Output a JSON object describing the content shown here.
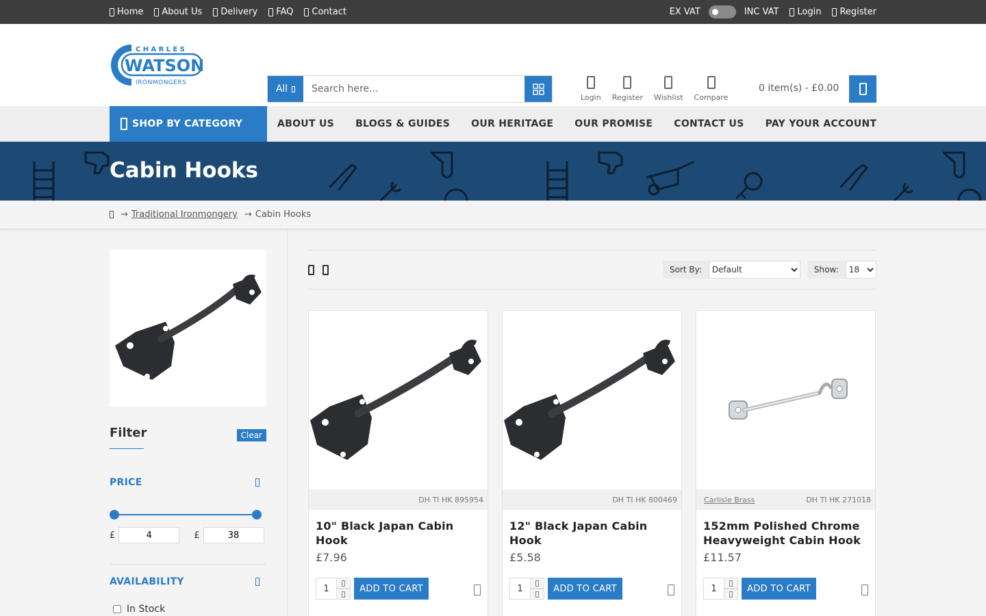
{
  "topbar": {
    "links": [
      "Home",
      "About Us",
      "Delivery",
      "FAQ",
      "Contact"
    ],
    "ex_vat": "EX VAT",
    "inc_vat": "INC VAT",
    "login": "Login",
    "register": "Register"
  },
  "logo": {
    "line1": "CHARLES",
    "line2": "WATSON",
    "line3": "IRONMONGERS",
    "color": "#2a7cc7"
  },
  "search": {
    "category": "All",
    "placeholder": "Search here..."
  },
  "header_icons": {
    "login": "Login",
    "register": "Register",
    "wishlist": "Wishlist",
    "compare": "Compare"
  },
  "cart": {
    "summary": "0 item(s) - £0.00"
  },
  "nav": {
    "shop": "SHOP BY CATEGORY",
    "links": [
      "ABOUT US",
      "BLOGS & GUIDES",
      "OUR HERITAGE",
      "OUR PROMISE",
      "CONTACT US",
      "PAY YOUR ACCOUNT"
    ]
  },
  "banner": {
    "title": "Cabin Hooks",
    "bg": "#1c4a75"
  },
  "breadcrumb": {
    "parent": "Traditional Ironmongery",
    "current": "Cabin Hooks",
    "sep": "→"
  },
  "filter": {
    "title": "Filter",
    "clear": "Clear",
    "price_title": "PRICE",
    "currency": "£",
    "min": "4",
    "max": "38",
    "availability_title": "AVAILABILITY",
    "in_stock": "In Stock"
  },
  "toolbar": {
    "sort_label": "Sort By:",
    "sort_value": "Default",
    "show_label": "Show:",
    "show_value": "18"
  },
  "products": [
    {
      "brand": "",
      "sku": "DH TI HK 895954",
      "name": "10\" Black Japan Cabin Hook",
      "price": "£7.96",
      "qty": "1",
      "add": "ADD TO CART"
    },
    {
      "brand": "",
      "sku": "DH TI HK 800469",
      "name": "12\" Black Japan Cabin Hook",
      "price": "£5.58",
      "qty": "1",
      "add": "ADD TO CART"
    },
    {
      "brand": "Carlisle Brass",
      "sku": "DH TI HK 271018",
      "name": "152mm Polished Chrome Heavyweight Cabin Hook",
      "price": "£11.57",
      "qty": "1",
      "add": "ADD TO CART"
    }
  ],
  "accent": "#2a7cc7"
}
